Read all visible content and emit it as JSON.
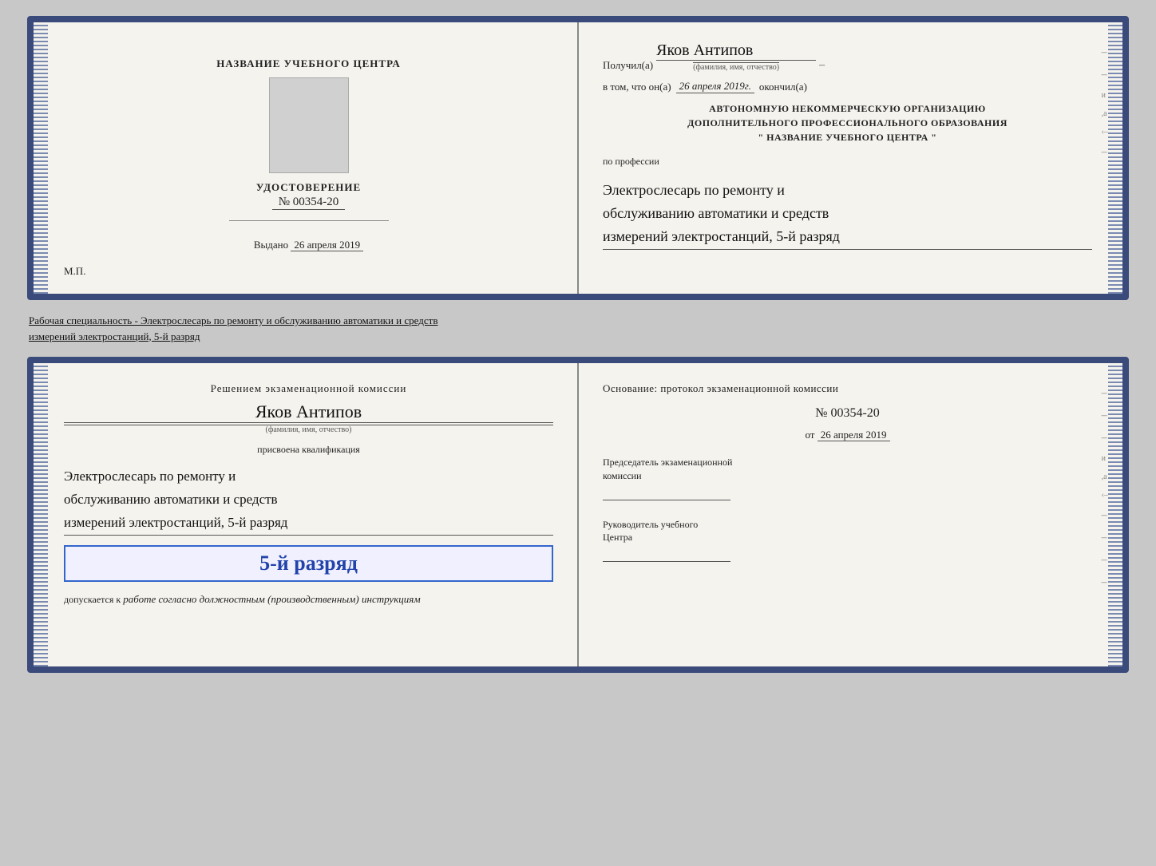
{
  "top_card": {
    "left": {
      "center_title": "НАЗВАНИЕ УЧЕБНОГО ЦЕНТРА",
      "udostoverenie_label": "УДОСТОВЕРЕНИЕ",
      "udostoverenie_num": "№ 00354-20",
      "vydano_label": "Выдано",
      "vydano_date": "26 апреля 2019",
      "mp": "М.П."
    },
    "right": {
      "poluchil_label": "Получил(а)",
      "recipient_name": "Яков Антипов",
      "fio_sublabel": "(фамилия, имя, отчество)",
      "vtom_prefix": "в том, что он(а)",
      "vtom_date": "26 апреля 2019г.",
      "okonchill_label": "окончил(а)",
      "org_line1": "АВТОНОМНУЮ НЕКОММЕРЧЕСКУЮ ОРГАНИЗАЦИЮ",
      "org_line2": "ДОПОЛНИТЕЛЬНОГО ПРОФЕССИОНАЛЬНОГО ОБРАЗОВАНИЯ",
      "org_line3": "\" НАЗВАНИЕ УЧЕБНОГО ЦЕНТРА \"",
      "po_professii": "по профессии",
      "profession1": "Электрослесарь по ремонту и",
      "profession2": "обслуживанию автоматики и средств",
      "profession3": "измерений электростанций, 5-й разряд"
    }
  },
  "middle_text": {
    "line1": "Рабочая специальность - Электрослесарь по ремонту и обслуживанию автоматики и средств",
    "line2": "измерений электростанций, 5-й разряд"
  },
  "bottom_card": {
    "left": {
      "reshenie_title": "Решением  экзаменационной  комиссии",
      "name": "Яков Антипов",
      "fio_sublabel": "(фамилия, имя, отчество)",
      "prisvoena_label": "присвоена квалификация",
      "qual1": "Электрослесарь по ремонту и",
      "qual2": "обслуживанию автоматики и средств",
      "qual3": "измерений электростанций, 5-й разряд",
      "razryad_badge": "5-й разряд",
      "dopuskaetsya_prefix": "допускается к",
      "dopuskaetsya_italic": "работе согласно должностным (производственным) инструкциям"
    },
    "right": {
      "osnovanie_title": "Основание: протокол экзаменационной комиссии",
      "protocol_num": "№  00354-20",
      "ot_label": "от",
      "ot_date": "26 апреля 2019",
      "predsedatel_title": "Председатель экзаменационной",
      "predsedatel_subtitle": "комиссии",
      "rukov_title": "Руководитель учебного",
      "rukov_subtitle": "Центра"
    }
  }
}
